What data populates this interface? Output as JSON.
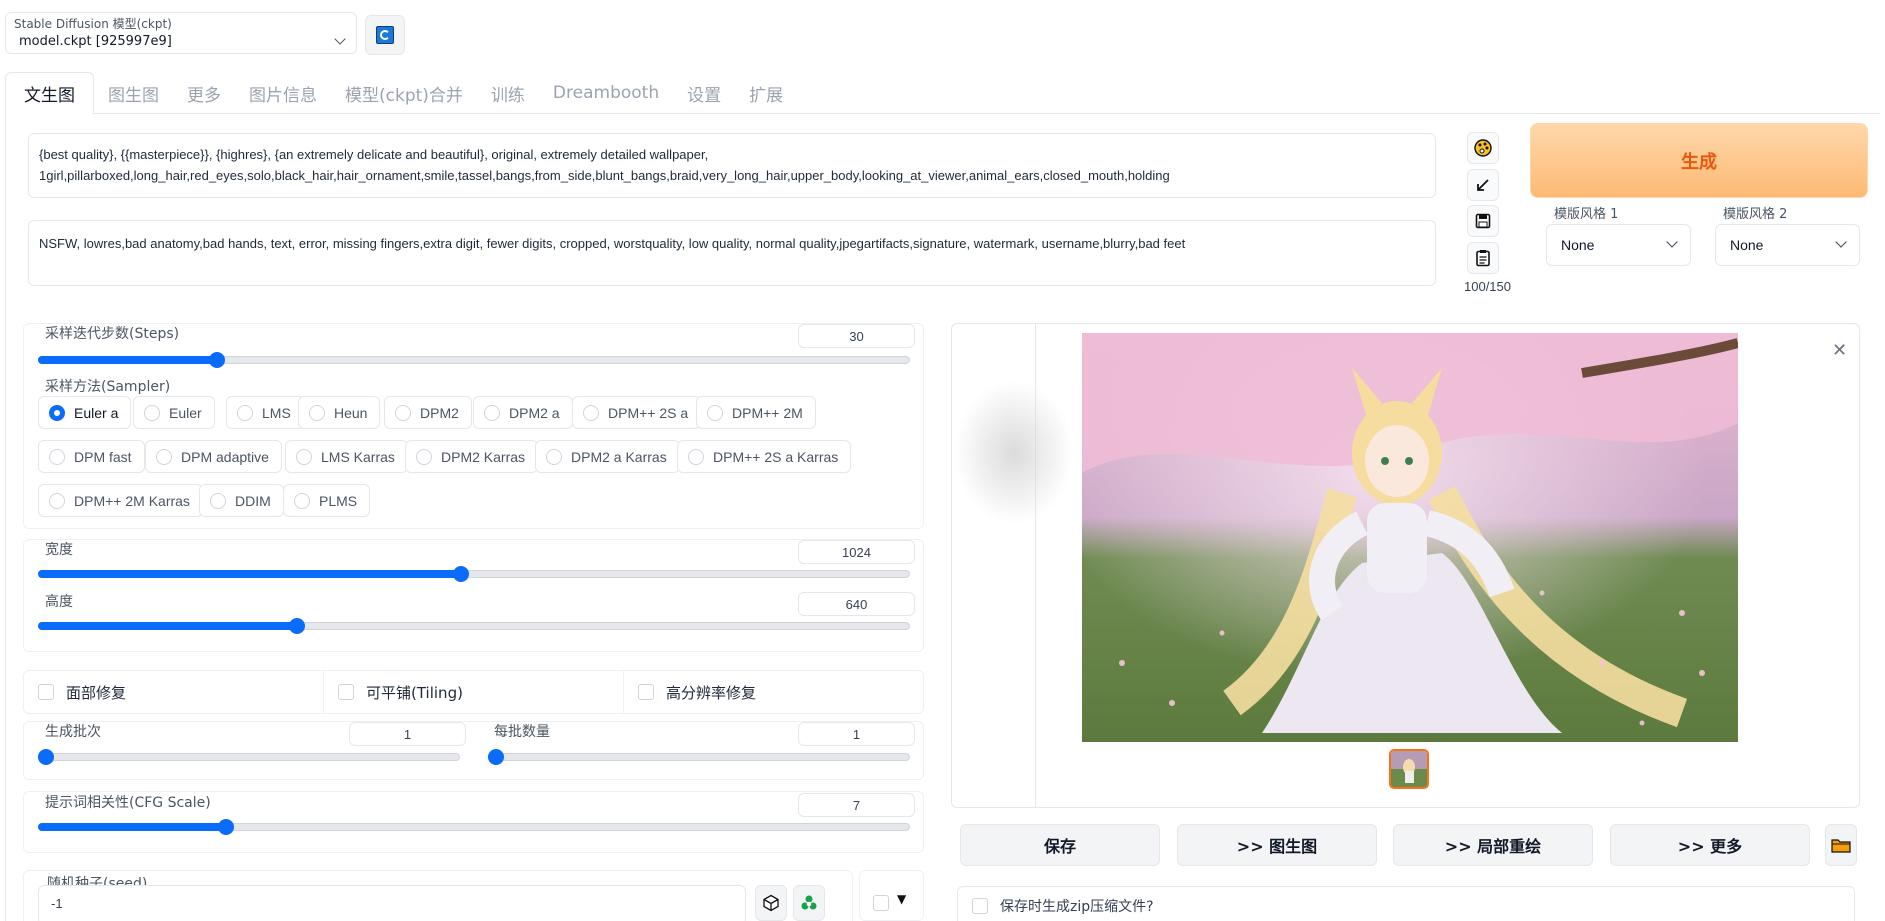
{
  "model": {
    "label": "Stable Diffusion 模型(ckpt)",
    "value": "model.ckpt [925997e9]"
  },
  "tabs": [
    {
      "label": "文生图",
      "active": true
    },
    {
      "label": "图生图"
    },
    {
      "label": "更多"
    },
    {
      "label": "图片信息"
    },
    {
      "label": "模型(ckpt)合并"
    },
    {
      "label": "训练"
    },
    {
      "label": "Dreambooth"
    },
    {
      "label": "设置"
    },
    {
      "label": "扩展"
    }
  ],
  "prompt": {
    "positive_line1": "{best quality}, {{masterpiece}}, {highres}, {an extremely delicate and beautiful}, original, extremely detailed wallpaper,",
    "positive_line2": "1girl,pillarboxed,long_hair,red_eyes,solo,black_hair,hair_ornament,smile,tassel,bangs,from_side,blunt_bangs,braid,very_long_hair,upper_body,looking_at_viewer,animal_ears,closed_mouth,holding",
    "negative": "NSFW, lowres,bad anatomy,bad hands, text, error, missing fingers,extra digit, fewer digits, cropped, worstquality, low quality, normal quality,jpegartifacts,signature, watermark, username,blurry,bad feet"
  },
  "tools": {
    "token_count": "100/150",
    "icons": [
      "palette-icon",
      "arrow-icon",
      "save-icon",
      "clipboard-icon"
    ]
  },
  "generate": {
    "label": "生成"
  },
  "styles": [
    {
      "label": "模版风格 1",
      "value": "None"
    },
    {
      "label": "模版风格 2",
      "value": "None"
    }
  ],
  "steps": {
    "label": "采样迭代步数(Steps)",
    "value": "30",
    "fraction": 0.2
  },
  "sampler": {
    "label": "采样方法(Sampler)",
    "selected": "Euler a",
    "options": [
      "Euler a",
      "Euler",
      "LMS",
      "Heun",
      "DPM2",
      "DPM2 a",
      "DPM++ 2S a",
      "DPM++ 2M",
      "DPM fast",
      "DPM adaptive",
      "LMS Karras",
      "DPM2 Karras",
      "DPM2 a Karras",
      "DPM++ 2S a Karras",
      "DPM++ 2M Karras",
      "DDIM",
      "PLMS"
    ]
  },
  "width": {
    "label": "宽度",
    "value": "1024",
    "fraction": 0.485
  },
  "height": {
    "label": "高度",
    "value": "640",
    "fraction": 0.293
  },
  "checks": [
    {
      "label": "面部修复",
      "checked": false
    },
    {
      "label": "可平铺(Tiling)",
      "checked": false
    },
    {
      "label": "高分辨率修复",
      "checked": false
    }
  ],
  "batch_count": {
    "label": "生成批次",
    "value": "1",
    "fraction": 0
  },
  "batch_size": {
    "label": "每批数量",
    "value": "1",
    "fraction": 0
  },
  "cfg": {
    "label": "提示词相关性(CFG Scale)",
    "value": "7",
    "fraction": 0.21
  },
  "seed": {
    "label": "随机种子(seed)",
    "value": "-1"
  },
  "output": {
    "actions": [
      "保存",
      ">> 图生图",
      ">> 局部重绘",
      ">> 更多"
    ],
    "zip_label": "保存时生成zip压缩文件?"
  },
  "colors": {
    "accent": "#0b6bfa",
    "generate_bg": "#fdba74",
    "generate_text": "#ea580c"
  }
}
